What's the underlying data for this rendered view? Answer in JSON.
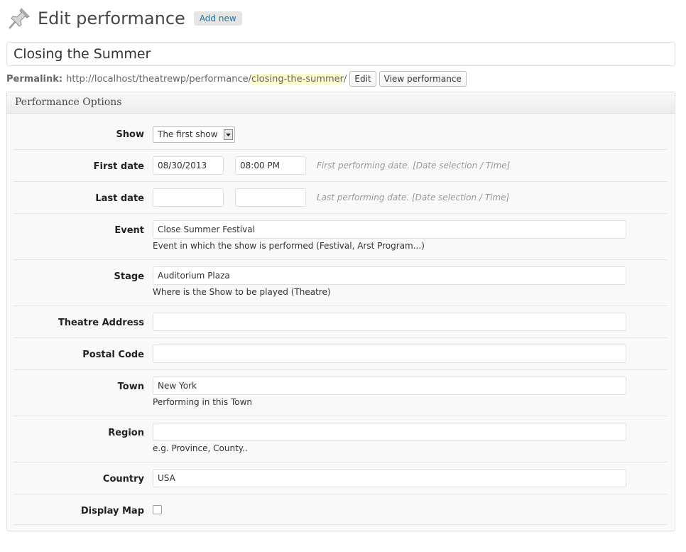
{
  "header": {
    "title": "Edit performance",
    "add_new_label": "Add new",
    "icon": "pushpin-icon"
  },
  "post_title": "Closing the Summer",
  "permalink": {
    "label": "Permalink:",
    "base_url": "http://localhost/theatrewp/performance/",
    "slug": "closing-the-summer",
    "trailing": "/",
    "edit_label": "Edit",
    "view_label": "View performance"
  },
  "box": {
    "title": "Performance Options"
  },
  "fields": {
    "show": {
      "label": "Show",
      "value": "The first show"
    },
    "first_date": {
      "label": "First date",
      "date": "08/30/2013",
      "time": "08:00 PM",
      "hint": "First performing date. [Date selection / Time]"
    },
    "last_date": {
      "label": "Last date",
      "date": "",
      "time": "",
      "hint": "Last performing date. [Date selection / Time]"
    },
    "event": {
      "label": "Event",
      "value": "Close Summer Festival",
      "desc": "Event in which the show is performed (Festival, Arst Program...)"
    },
    "stage": {
      "label": "Stage",
      "value": "Auditorium Plaza",
      "desc": "Where is the Show to be played (Theatre)"
    },
    "theatre_address": {
      "label": "Theatre Address",
      "value": ""
    },
    "postal_code": {
      "label": "Postal Code",
      "value": ""
    },
    "town": {
      "label": "Town",
      "value": "New York",
      "desc": "Performing in this Town"
    },
    "region": {
      "label": "Region",
      "value": "",
      "desc": "e.g. Province, County.."
    },
    "country": {
      "label": "Country",
      "value": "USA"
    },
    "display_map": {
      "label": "Display Map",
      "checked": false
    }
  }
}
